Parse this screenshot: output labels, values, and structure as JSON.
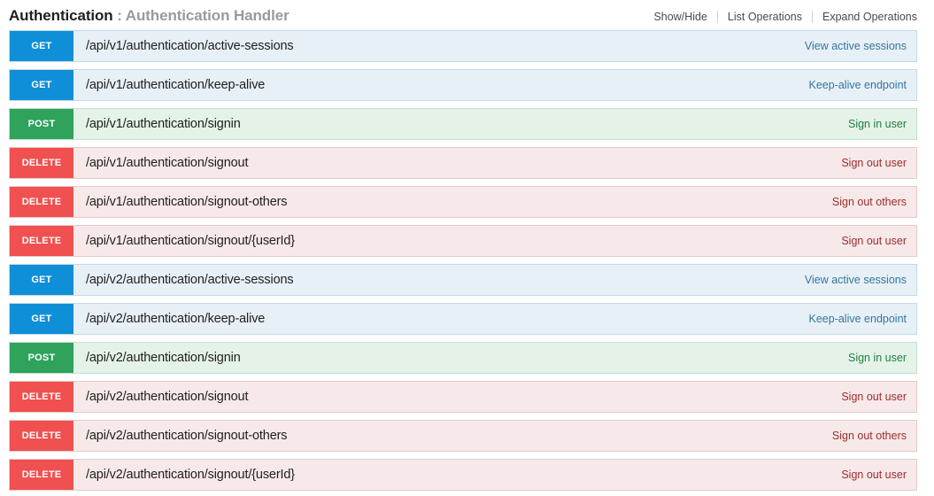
{
  "resource": {
    "name": "Authentication",
    "separator": " : ",
    "description": "Authentication Handler"
  },
  "options": {
    "show_hide": "Show/Hide",
    "list_operations": "List Operations",
    "expand_operations": "Expand Operations"
  },
  "colors": {
    "get_badge": "#0f8fd8",
    "get_background": "#e7f0f7",
    "get_text": "#34769e",
    "post_badge": "#2fa25c",
    "post_background": "#e5f2e8",
    "post_text": "#1f8143",
    "delete_badge": "#f0504f",
    "delete_background": "#f7e9e9",
    "delete_text": "#9c2c2c"
  },
  "operations": [
    {
      "method": "GET",
      "path": "/api/v1/authentication/active-sessions",
      "summary": "View active sessions"
    },
    {
      "method": "GET",
      "path": "/api/v1/authentication/keep-alive",
      "summary": "Keep-alive endpoint"
    },
    {
      "method": "POST",
      "path": "/api/v1/authentication/signin",
      "summary": "Sign in user"
    },
    {
      "method": "DELETE",
      "path": "/api/v1/authentication/signout",
      "summary": "Sign out user"
    },
    {
      "method": "DELETE",
      "path": "/api/v1/authentication/signout-others",
      "summary": "Sign out others"
    },
    {
      "method": "DELETE",
      "path": "/api/v1/authentication/signout/{userId}",
      "summary": "Sign out user"
    },
    {
      "method": "GET",
      "path": "/api/v2/authentication/active-sessions",
      "summary": "View active sessions"
    },
    {
      "method": "GET",
      "path": "/api/v2/authentication/keep-alive",
      "summary": "Keep-alive endpoint"
    },
    {
      "method": "POST",
      "path": "/api/v2/authentication/signin",
      "summary": "Sign in user"
    },
    {
      "method": "DELETE",
      "path": "/api/v2/authentication/signout",
      "summary": "Sign out user"
    },
    {
      "method": "DELETE",
      "path": "/api/v2/authentication/signout-others",
      "summary": "Sign out others"
    },
    {
      "method": "DELETE",
      "path": "/api/v2/authentication/signout/{userId}",
      "summary": "Sign out user"
    }
  ]
}
